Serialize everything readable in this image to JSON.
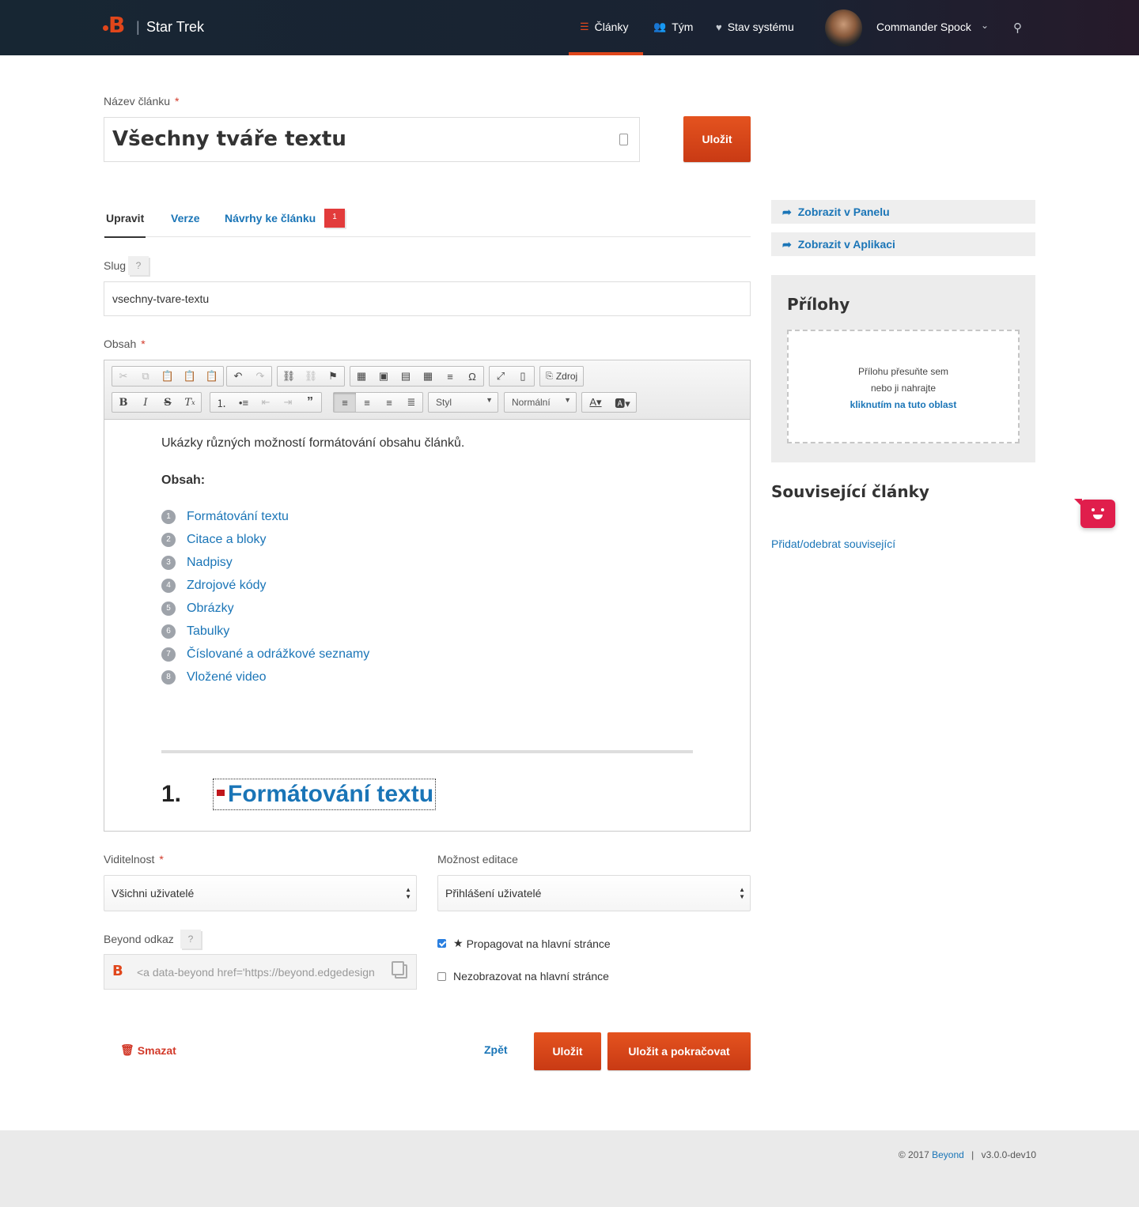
{
  "header": {
    "brand": "Star Trek",
    "nav": [
      {
        "label": "Články",
        "icon": "list-icon"
      },
      {
        "label": "Tým",
        "icon": "users-icon"
      },
      {
        "label": "Stav systému",
        "icon": "heartbeat-icon"
      }
    ],
    "user_name": "Commander Spock"
  },
  "form": {
    "title_label": "Název článku",
    "title_value": "Všechny tváře textu",
    "save_label": "Uložit",
    "tabs": [
      {
        "label": "Upravit",
        "active": true
      },
      {
        "label": "Verze"
      },
      {
        "label": "Návrhy ke článku"
      }
    ],
    "suggestions_badge": "1",
    "slug_label": "Slug",
    "slug_value": "vsechny-tvare-textu",
    "help_mark": "?",
    "content_label": "Obsah",
    "visibility_label": "Viditelnost",
    "visibility_value": "Všichni uživatelé",
    "editing_label": "Možnost editace",
    "editing_value": "Přihlášení uživatelé",
    "beyond_link_label": "Beyond odkaz",
    "beyond_link_value": "<a data-beyond href='https://beyond.edgedesign",
    "promote_label": "Propagovat na hlavní stránce",
    "promote_checked": true,
    "hide_label": "Nezobrazovat na hlavní stránce",
    "hide_checked": false,
    "delete_label": "Smazat",
    "back_label": "Zpět",
    "save_continue_label": "Uložit a pokračovat"
  },
  "editor": {
    "source_label": "Zdroj",
    "style_combo": "Styl",
    "format_combo": "Normální",
    "intro": "Ukázky různých možností formátování obsahu článků.",
    "toc_heading": "Obsah:",
    "toc": [
      {
        "num": "1",
        "label": "Formátování textu"
      },
      {
        "num": "2",
        "label": "Citace a bloky"
      },
      {
        "num": "3",
        "label": "Nadpisy"
      },
      {
        "num": "4",
        "label": "Zdrojové kódy"
      },
      {
        "num": "5",
        "label": "Obrázky"
      },
      {
        "num": "6",
        "label": "Tabulky"
      },
      {
        "num": "7",
        "label": "Číslované a odrážkové seznamy"
      },
      {
        "num": "8",
        "label": "Vložené video"
      }
    ],
    "section_number": "1.",
    "section_title": "Formátování textu"
  },
  "sidebar": {
    "view_panel": "Zobrazit v Panelu",
    "view_app": "Zobrazit v Aplikaci",
    "attachments_title": "Přílohy",
    "drop_line1": "Přílohu přesuňte sem",
    "drop_line2": "nebo ji nahrajte",
    "drop_link": "kliknutím na tuto oblast",
    "related_title": "Související články",
    "related_link": "Přidat/odebrat související"
  },
  "footer": {
    "copyright": "© 2017",
    "brand_link": "Beyond",
    "separator": "|",
    "version": "v3.0.0-dev10"
  },
  "colors": {
    "accent": "#e0461b",
    "link": "#1a75b7",
    "header_bg": "#172633"
  }
}
